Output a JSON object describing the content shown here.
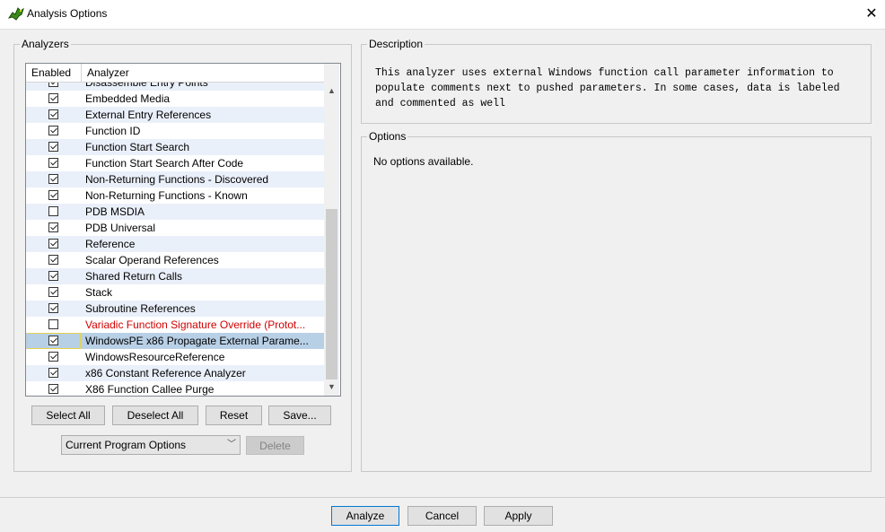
{
  "window": {
    "title": "Analysis Options",
    "close_glyph": "✕"
  },
  "analyzers": {
    "legend": "Analyzers",
    "columns": {
      "enabled": "Enabled",
      "analyzer": "Analyzer"
    },
    "rows": [
      {
        "label": "Disassemble Entry Points",
        "checked": true,
        "red": false
      },
      {
        "label": "Embedded Media",
        "checked": true,
        "red": false
      },
      {
        "label": "External Entry References",
        "checked": true,
        "red": false
      },
      {
        "label": "Function ID",
        "checked": true,
        "red": false
      },
      {
        "label": "Function Start Search",
        "checked": true,
        "red": false
      },
      {
        "label": "Function Start Search After Code",
        "checked": true,
        "red": false
      },
      {
        "label": "Non-Returning Functions - Discovered",
        "checked": true,
        "red": false
      },
      {
        "label": "Non-Returning Functions - Known",
        "checked": true,
        "red": false
      },
      {
        "label": "PDB MSDIA",
        "checked": false,
        "red": false
      },
      {
        "label": "PDB Universal",
        "checked": true,
        "red": false
      },
      {
        "label": "Reference",
        "checked": true,
        "red": false
      },
      {
        "label": "Scalar Operand References",
        "checked": true,
        "red": false
      },
      {
        "label": "Shared Return Calls",
        "checked": true,
        "red": false
      },
      {
        "label": "Stack",
        "checked": true,
        "red": false
      },
      {
        "label": "Subroutine References",
        "checked": true,
        "red": false
      },
      {
        "label": "Variadic Function Signature Override (Protot...",
        "checked": false,
        "red": true
      },
      {
        "label": "WindowsPE x86 Propagate External Parame...",
        "checked": true,
        "red": false,
        "selected": true
      },
      {
        "label": "WindowsResourceReference",
        "checked": true,
        "red": false
      },
      {
        "label": "x86 Constant Reference Analyzer",
        "checked": true,
        "red": false
      },
      {
        "label": "X86 Function Callee Purge",
        "checked": true,
        "red": false
      }
    ],
    "buttons": {
      "select_all": "Select All",
      "deselect_all": "Deselect All",
      "reset": "Reset",
      "save": "Save..."
    },
    "combo_value": "Current Program Options",
    "delete_label": "Delete"
  },
  "description": {
    "legend": "Description",
    "lines": [
      "This analyzer uses external Windows function call parameter information to",
      "populate comments next to pushed parameters. In some cases, data is labeled",
      "and commented as well"
    ]
  },
  "options": {
    "legend": "Options",
    "text": "No options available."
  },
  "footer": {
    "analyze": "Analyze",
    "cancel": "Cancel",
    "apply": "Apply"
  },
  "colors": {
    "selection": "#b8d0e6",
    "alt_row": "#eaf0fa",
    "red_text": "#d00000",
    "default_button_border": "#0078d7"
  }
}
